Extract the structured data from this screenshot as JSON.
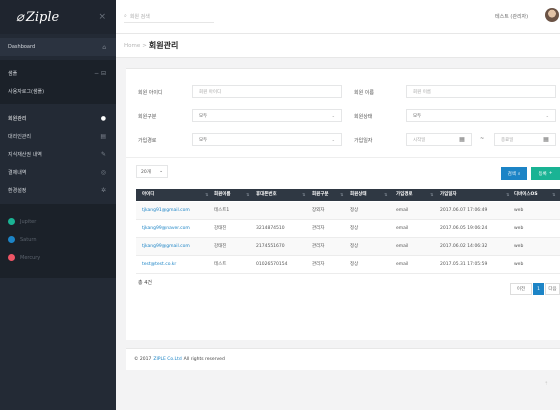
{
  "app": {
    "logo": "Ziple",
    "logo_mark": "⌀",
    "close_icon": "×"
  },
  "sidebar": {
    "items": [
      {
        "label": "Dashboard",
        "icon": "home-icon",
        "glyph": "⌂"
      },
      {
        "label": "샘플",
        "icon": "collapse-icon",
        "glyph": "−  ⊟"
      },
      {
        "label": "사용자로그(샘플)",
        "icon": "",
        "glyph": ""
      },
      {
        "label": "회원관리",
        "icon": "user-icon",
        "glyph": "●"
      },
      {
        "label": "대리인관리",
        "icon": "list-icon",
        "glyph": "▤"
      },
      {
        "label": "지식재산권 내역",
        "icon": "edit-icon",
        "glyph": "✎"
      },
      {
        "label": "결제내역",
        "icon": "card-icon",
        "glyph": "◎"
      },
      {
        "label": "환경설정",
        "icon": "gear-icon",
        "glyph": "✲"
      }
    ],
    "planets": [
      {
        "label": "Jupiter",
        "color": "#1ab394"
      },
      {
        "label": "Saturn",
        "color": "#1c84c6"
      },
      {
        "label": "Mercury",
        "color": "#ed5565"
      }
    ]
  },
  "topbar": {
    "search_placeholder": "회원 검색",
    "search_icon": "⌕",
    "user": "테스트 (관리자)"
  },
  "breadcrumb": {
    "home": "Home",
    "separator": ">",
    "title": "회원관리"
  },
  "filters": {
    "member_id": {
      "label": "회원 아이디",
      "placeholder": "회원 아이디"
    },
    "member_name": {
      "label": "회원 이름",
      "placeholder": "회원 이름"
    },
    "member_type": {
      "label": "회원구분",
      "value": "모두"
    },
    "member_status": {
      "label": "회원상태",
      "value": "모두"
    },
    "signup_path": {
      "label": "가입경로",
      "value": "모두"
    },
    "signup_date": {
      "label": "가입일자",
      "start_placeholder": "시작일",
      "end_placeholder": "종료일",
      "tilde": "~"
    },
    "dropdown_arrow": "⌄",
    "calendar_icon": "▦"
  },
  "toolbar": {
    "page_size": "20개",
    "search_button": "검색",
    "search_icon": "⌕",
    "add_button": "등록",
    "add_icon": "+"
  },
  "table": {
    "sort_icon": "⇅",
    "headers": [
      "아이디",
      "회원이름",
      "휴대폰번호",
      "회원구분",
      "회원상태",
      "가입경로",
      "가입일자",
      "디바이스OS"
    ],
    "rows": [
      [
        "tjkang91@gmail.com",
        "테스트1",
        "",
        "장외자",
        "정상",
        "email",
        "2017.06.07 17:06:49",
        "web"
      ],
      [
        "tjkang99@naver.com",
        "강태진",
        "3214874510",
        "관리자",
        "정상",
        "email",
        "2017.06.05 19:06:24",
        "web"
      ],
      [
        "tjkang99@gmail.com",
        "강태진",
        "2174551670",
        "관리자",
        "정상",
        "email",
        "2017.06.02 14:06:32",
        "web"
      ],
      [
        "test@test.co.kr",
        "테스트",
        "01026570154",
        "관리자",
        "정상",
        "email",
        "2017.05.31 17:05:59",
        "web"
      ]
    ],
    "total": "총 4건"
  },
  "pagination": {
    "prev": "이전",
    "current": "1",
    "next": "다음"
  },
  "footer": {
    "prefix": "© 2017",
    "brand": "ZIPLE Co.Ltd",
    "suffix": "All rights reserved"
  },
  "scroll_top_icon": "⇡"
}
